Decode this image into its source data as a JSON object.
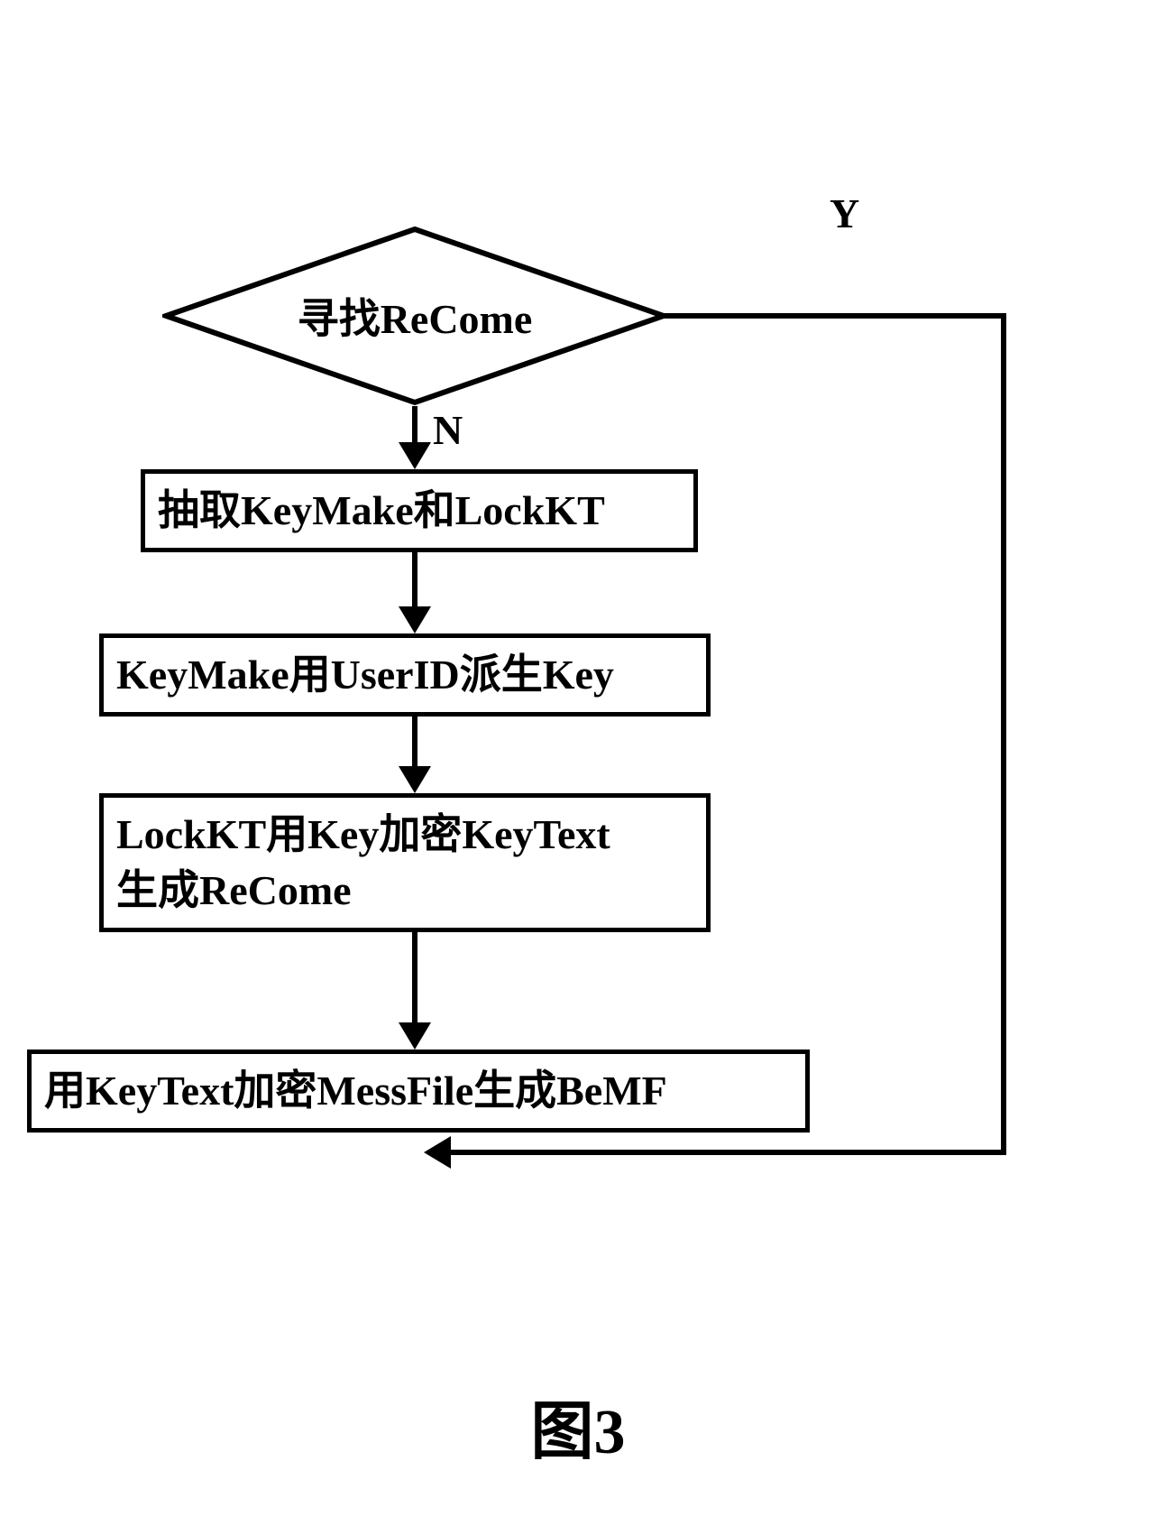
{
  "flowchart": {
    "decision": "寻找ReCome",
    "branch_yes": "Y",
    "branch_no": "N",
    "step1": "抽取KeyMake和LockKT",
    "step2": "KeyMake用UserID派生Key",
    "step3": "LockKT用Key加密KeyText\n生成ReCome",
    "step4": "用KeyText加密MessFile生成BeMF",
    "caption": "图3"
  }
}
